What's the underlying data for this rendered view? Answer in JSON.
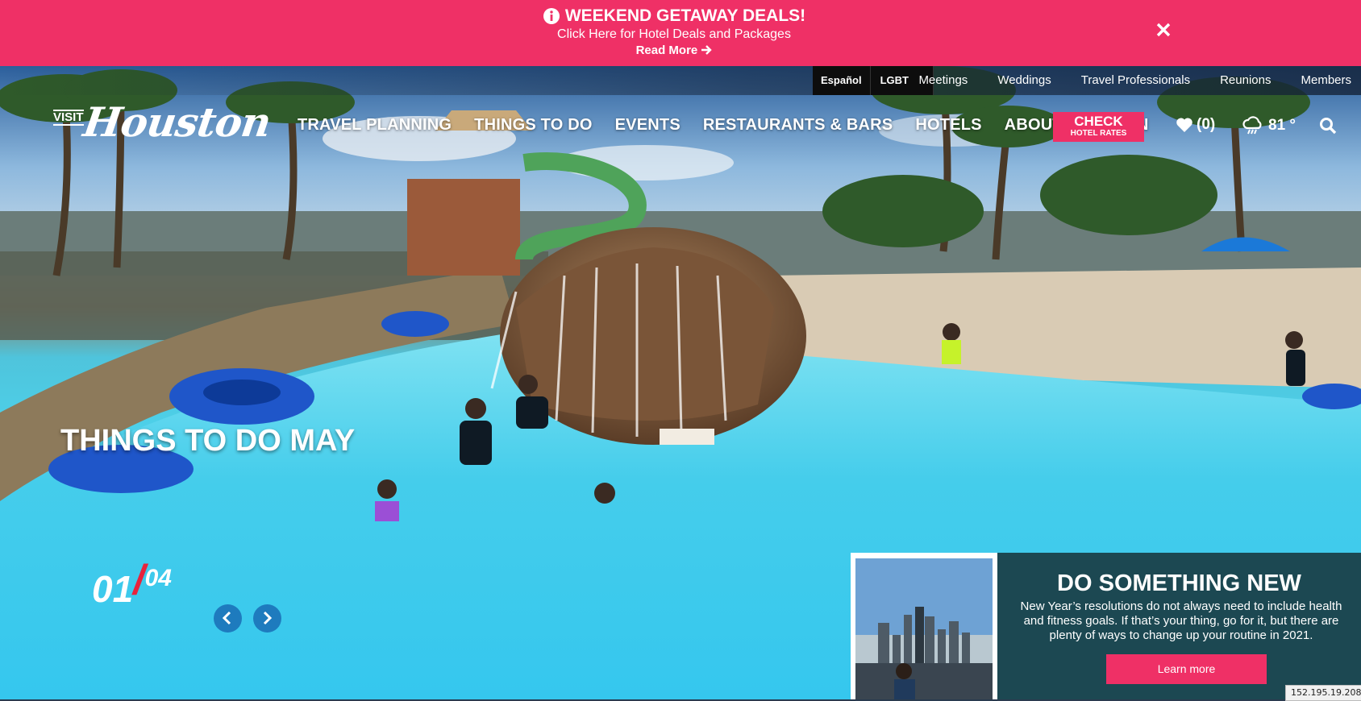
{
  "promo_banner": {
    "title": "WEEKEND GETAWAY DEALS!",
    "subtitle": "Click Here for Hotel Deals and Packages",
    "read_more": "Read More",
    "background_color": "#ef3066"
  },
  "utility_nav": {
    "languages": [
      "Español",
      "LGBT"
    ],
    "links": [
      "Meetings",
      "Weddings",
      "Travel Professionals",
      "Reunions",
      "Members"
    ]
  },
  "logo": {
    "visit": "VISIT",
    "city": "Houston"
  },
  "main_nav": {
    "items": [
      "TRAVEL PLANNING",
      "THINGS TO DO",
      "EVENTS",
      "RESTAURANTS & BARS",
      "HOTELS",
      "ABOUT HOUSTON"
    ]
  },
  "check_rates": {
    "line1": "CHECK",
    "line2": "HOTEL RATES"
  },
  "favorites": {
    "count": "(0)",
    "icon": "heart-icon"
  },
  "weather": {
    "temp": "81 °",
    "icon": "cloud-rain-icon"
  },
  "hero": {
    "slide_title": "THINGS TO DO MAY",
    "current_slide": "01",
    "total_slides": "04"
  },
  "promo_card": {
    "title": "DO SOMETHING NEW",
    "text": "New Year’s resolutions do not always need to include health and fitness goals. If that’s your thing, go for it, but there are plenty of ways to change up your routine in 2021.",
    "button": "Learn more"
  },
  "ip_label": "152.195.19.208"
}
